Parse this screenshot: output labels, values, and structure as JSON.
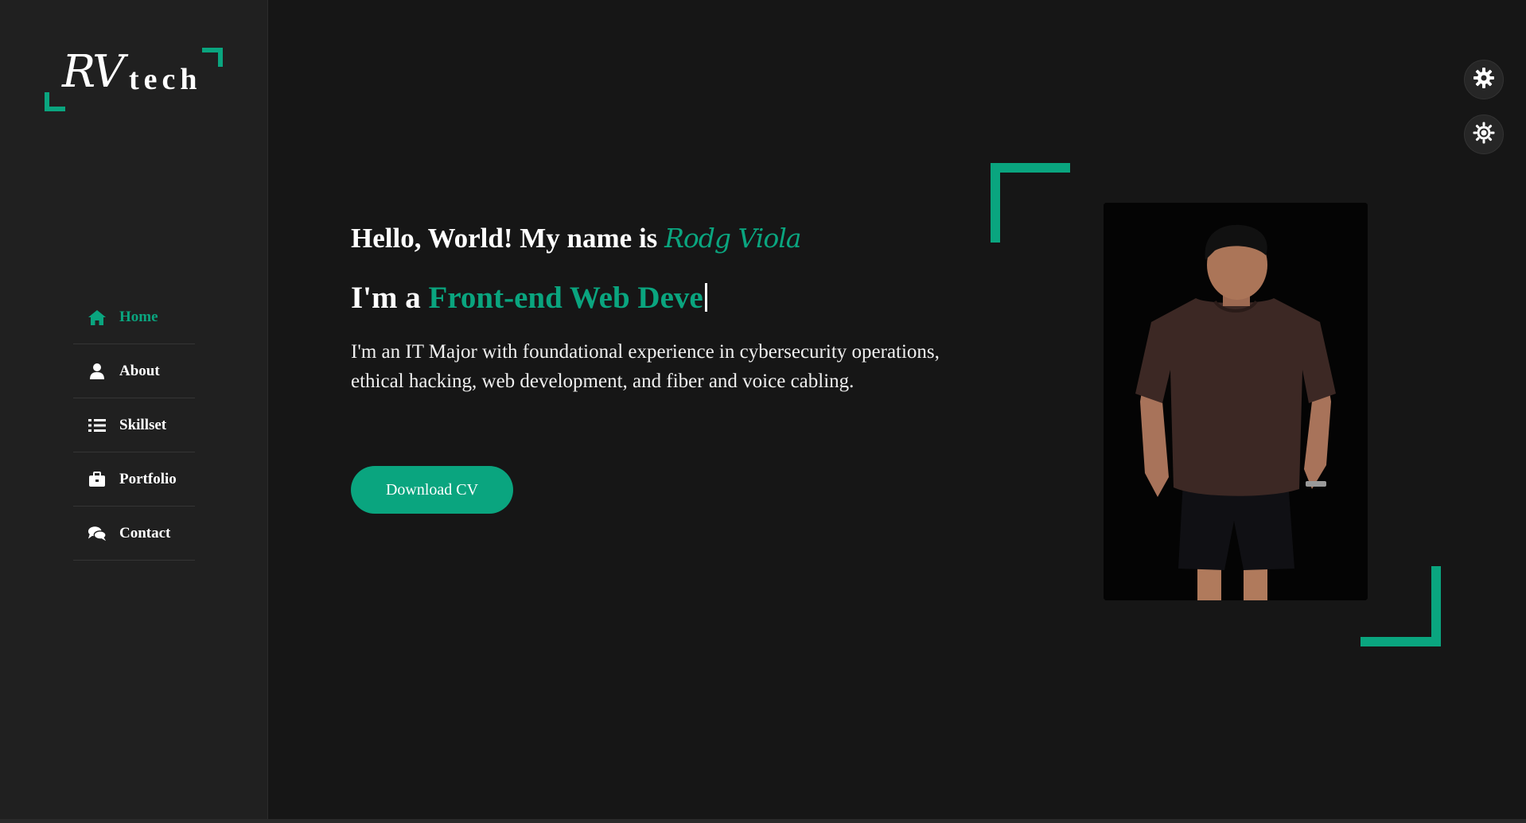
{
  "logo": {
    "script": "RV",
    "word": "tech"
  },
  "colors": {
    "accent": "#0aa57f",
    "background": "#161616",
    "sidebar": "#202020"
  },
  "nav": {
    "items": [
      {
        "label": "Home",
        "icon": "home-icon",
        "active": true
      },
      {
        "label": "About",
        "icon": "user-icon",
        "active": false
      },
      {
        "label": "Skillset",
        "icon": "list-icon",
        "active": false
      },
      {
        "label": "Portfolio",
        "icon": "briefcase-icon",
        "active": false
      },
      {
        "label": "Contact",
        "icon": "comments-icon",
        "active": false
      }
    ]
  },
  "hero": {
    "greeting": "Hello, World! My name is ",
    "name": "Rodg Viola",
    "role_prefix": "I'm a ",
    "role_typed": "Front-end Web Deve",
    "description": "I'm an IT Major with foundational experience in cybersecurity operations, ethical hacking, web development, and fiber and voice cabling.",
    "cv_button": "Download CV"
  },
  "floating_buttons": [
    {
      "icon": "gear-icon"
    },
    {
      "icon": "sun-gear-icon"
    }
  ]
}
